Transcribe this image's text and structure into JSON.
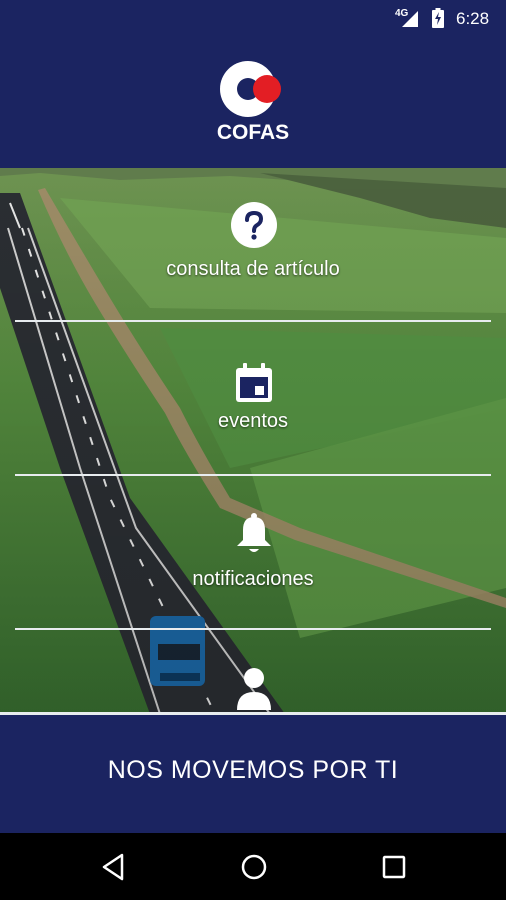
{
  "status_bar": {
    "network": "4G",
    "time": "6:28"
  },
  "brand": {
    "logo_text": "COFAS",
    "accent_color": "#e31e24",
    "primary_color": "#1b2461"
  },
  "menu": {
    "items": [
      {
        "label": "consulta de artículo",
        "icon": "help-circle-icon"
      },
      {
        "label": "eventos",
        "icon": "calendar-icon"
      },
      {
        "label": "notificaciones",
        "icon": "bell-icon"
      },
      {
        "label": "",
        "icon": "person-icon"
      }
    ]
  },
  "footer": {
    "tagline": "NOS MOVEMOS POR TI"
  },
  "nav": {
    "back": "back-icon",
    "home": "home-icon",
    "recents": "recents-icon"
  }
}
